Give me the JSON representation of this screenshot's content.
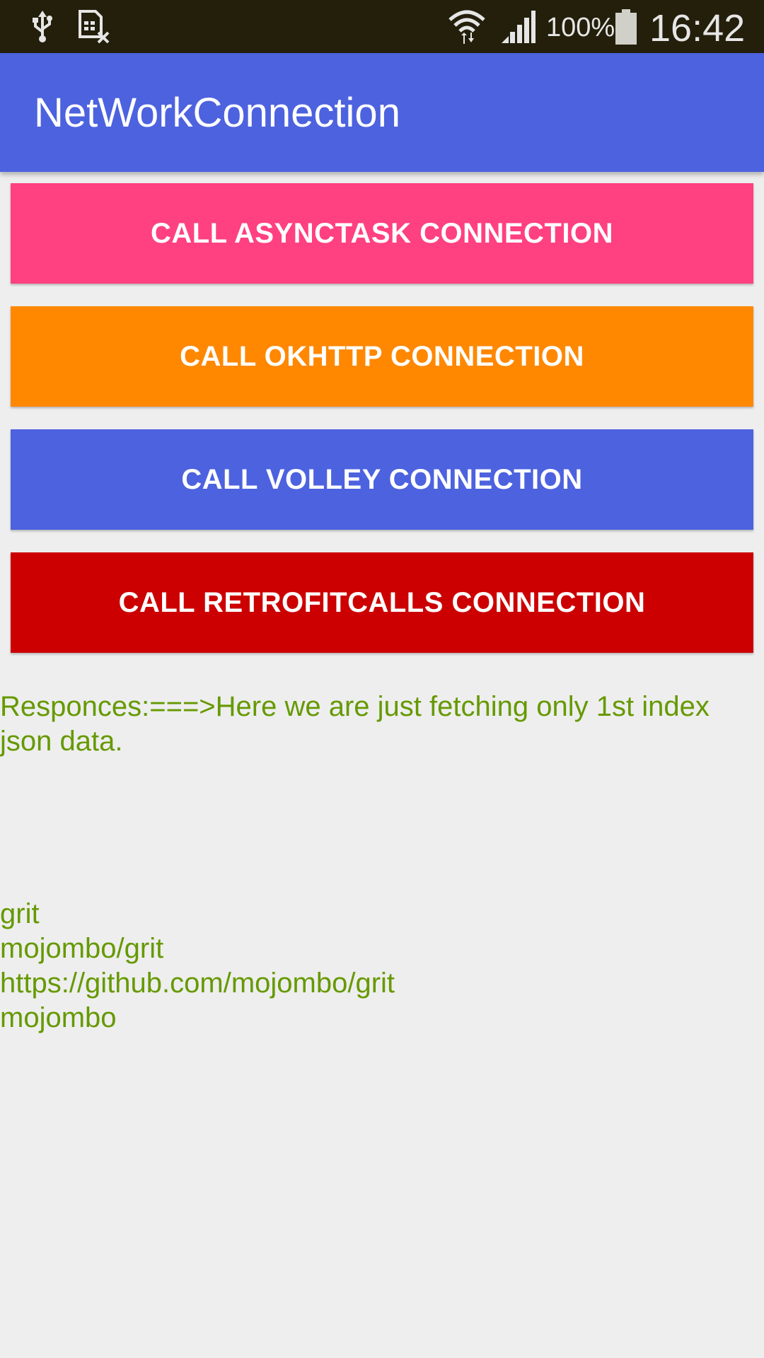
{
  "status_bar": {
    "icons": [
      "usb-icon",
      "sim-card-off-icon",
      "wifi-icon",
      "signal-icon",
      "battery-icon"
    ],
    "battery_percent": "100%",
    "time": "16:42"
  },
  "app_bar": {
    "title": "NetWorkConnection",
    "color": "#4c62df"
  },
  "buttons": [
    {
      "label": "CALL ASYNCTASK CONNECTION",
      "color": "#ff4081"
    },
    {
      "label": "CALL OKHTTP CONNECTION",
      "color": "#ff8800"
    },
    {
      "label": "CALL VOLLEY CONNECTION",
      "color": "#4c62df"
    },
    {
      "label": "CALL RETROFITCALLS CONNECTION",
      "color": "#cc0000"
    }
  ],
  "response": {
    "text": "Responces:===>Here we are just fetching only 1st index json data.",
    "color": "#669900"
  },
  "result": {
    "name": "grit",
    "full_name": "mojombo/grit",
    "url": "https://github.com/mojombo/grit",
    "owner": "mojombo"
  }
}
